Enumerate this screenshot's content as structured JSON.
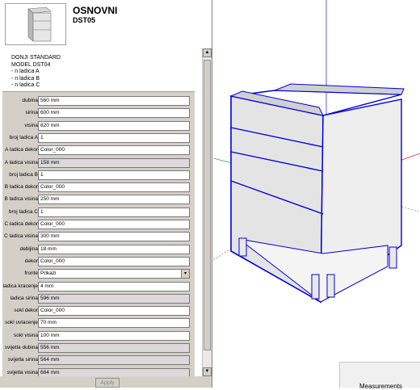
{
  "header": {
    "title": "OSNOVNI",
    "code": "DST05"
  },
  "description": [
    "DONJI STANDARD",
    "MODEL DST04",
    "- n ladica A",
    "- n ladica B",
    "- n ladica C"
  ],
  "fields": [
    {
      "label": "dubina",
      "value": "560 mm",
      "readonly": false
    },
    {
      "label": "sirina",
      "value": "600 mm",
      "readonly": false
    },
    {
      "label": "visina",
      "value": "820 mm",
      "readonly": false
    },
    {
      "label": "broj ladica A",
      "value": "1",
      "readonly": false
    },
    {
      "label": "A ladica dekor",
      "value": "Color_000",
      "readonly": false
    },
    {
      "label": "A ladica visina",
      "value": "158 mm",
      "readonly": true
    },
    {
      "label": "broj ladica B",
      "value": "1",
      "readonly": false
    },
    {
      "label": "B ladica dekor",
      "value": "Color_000",
      "readonly": false
    },
    {
      "label": "B ladica visina",
      "value": "250 mm",
      "readonly": false
    },
    {
      "label": "broj ladica C",
      "value": "1",
      "readonly": false
    },
    {
      "label": "C ladica dekor",
      "value": "Color_000",
      "readonly": false
    },
    {
      "label": "C ladica visina",
      "value": "300 mm",
      "readonly": false
    },
    {
      "label": "debljina",
      "value": "18 mm",
      "readonly": false
    },
    {
      "label": "dekor",
      "value": "Color_000",
      "readonly": false
    },
    {
      "label": "fronte",
      "value": "Prikazi",
      "readonly": false,
      "select": true
    },
    {
      "label": "ladica kracenje",
      "value": "4 mm",
      "readonly": false
    },
    {
      "label": "ladica sirina",
      "value": "596 mm",
      "readonly": true
    },
    {
      "label": "sokl dekor",
      "value": "Color_000",
      "readonly": false
    },
    {
      "label": "sokl uvlacenje",
      "value": "70 mm",
      "readonly": false
    },
    {
      "label": "sokl visina",
      "value": "100 mm",
      "readonly": false
    },
    {
      "label": "svijetla dubina",
      "value": "556 mm",
      "readonly": true
    },
    {
      "label": "svijetla sirina",
      "value": "564 mm",
      "readonly": true
    },
    {
      "label": "svijetla visina",
      "value": "684 mm",
      "readonly": true
    }
  ],
  "apply_label": "Apply",
  "status": {
    "measurements_label": "Measurements"
  },
  "colors": {
    "selection": "#0000dd",
    "panel": "#d4d0c8",
    "cabinet": "#ececec",
    "axis_red": "#e03030",
    "axis_green": "#30b030",
    "axis_blue": "#3030e0"
  }
}
